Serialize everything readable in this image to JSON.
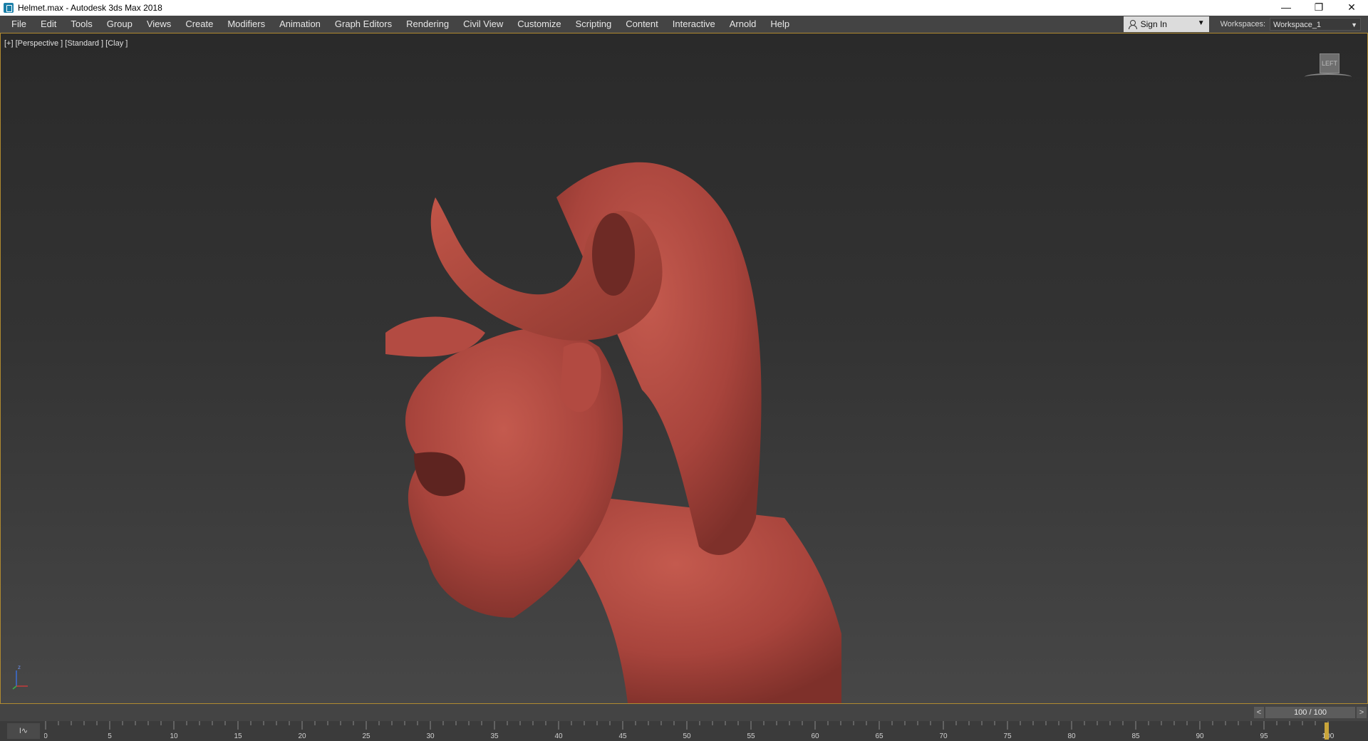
{
  "window": {
    "title": "Helmet.max - Autodesk 3ds Max 2018",
    "controls": {
      "minimize": "—",
      "restore": "❐",
      "close": "✕"
    }
  },
  "menu": {
    "items": [
      {
        "label": "File"
      },
      {
        "label": "Edit"
      },
      {
        "label": "Tools"
      },
      {
        "label": "Group"
      },
      {
        "label": "Views"
      },
      {
        "label": "Create"
      },
      {
        "label": "Modifiers"
      },
      {
        "label": "Animation"
      },
      {
        "label": "Graph Editors"
      },
      {
        "label": "Rendering"
      },
      {
        "label": "Civil View"
      },
      {
        "label": "Customize"
      },
      {
        "label": "Scripting"
      },
      {
        "label": "Content"
      },
      {
        "label": "Interactive"
      },
      {
        "label": "Arnold"
      },
      {
        "label": "Help"
      }
    ],
    "sign_in": "Sign In",
    "workspaces_label": "Workspaces:",
    "workspace_value": "Workspace_1"
  },
  "viewport": {
    "label": "[+] [Perspective ] [Standard ] [Clay ]",
    "viewcube_face": "LEFT",
    "axis_label": "z",
    "border_color": "#b08a30",
    "model_color": "#a8443c"
  },
  "timeline": {
    "readout": "100 / 100",
    "prev": "<",
    "next": ">",
    "ticks": [
      "0",
      "5",
      "10",
      "15",
      "20",
      "25",
      "30",
      "35",
      "40",
      "45",
      "50",
      "55",
      "60",
      "65",
      "70",
      "75",
      "80",
      "85",
      "90",
      "95",
      "100"
    ],
    "current_frame": 100
  },
  "icons": {
    "app": "3dsmax-app-icon",
    "sign_in": "user-icon"
  }
}
